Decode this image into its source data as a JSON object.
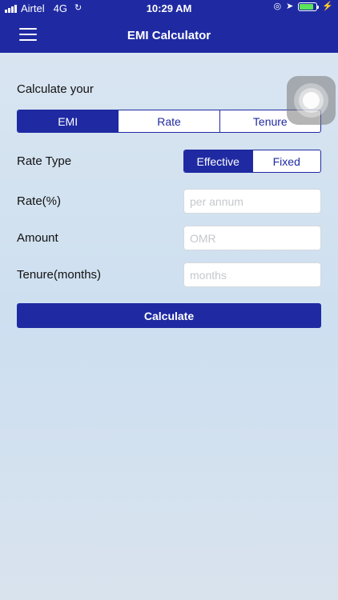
{
  "status_bar": {
    "carrier": "Airtel",
    "network": "4G",
    "time": "10:29 AM",
    "battery_level": 0.85,
    "battery_color": "#5be35b"
  },
  "header": {
    "title": "EMI Calculator",
    "menu_icon": "hamburger-menu-icon",
    "color": "#1f2aa2"
  },
  "calculate": {
    "label": "Calculate your",
    "options": [
      "EMI",
      "Rate",
      "Tenure"
    ],
    "selected": "EMI"
  },
  "rate_type": {
    "label": "Rate Type",
    "options": [
      "Effective",
      "Fixed"
    ],
    "selected": "Effective"
  },
  "fields": {
    "rate": {
      "label": "Rate(%)",
      "placeholder": "per annum",
      "value": ""
    },
    "amount": {
      "label": "Amount",
      "placeholder": "OMR",
      "value": ""
    },
    "tenure": {
      "label": "Tenure(months)",
      "placeholder": "months",
      "value": ""
    }
  },
  "actions": {
    "calculate_label": "Calculate"
  }
}
